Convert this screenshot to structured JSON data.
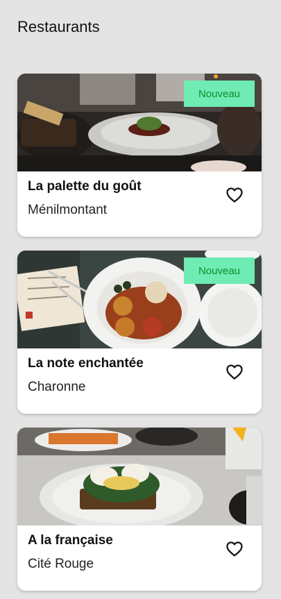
{
  "page": {
    "title": "Restaurants"
  },
  "restaurants": [
    {
      "name": "La palette du goût",
      "area": "Ménilmontant",
      "badge": "Nouveau"
    },
    {
      "name": "La note enchantée",
      "area": "Charonne",
      "badge": "Nouveau"
    },
    {
      "name": "A la française",
      "area": "Cité Rouge"
    }
  ],
  "colors": {
    "background": "#e4e4e4",
    "badge_bg": "#6fecb3",
    "badge_text": "#118a2b"
  },
  "icons": {
    "favorite": "heart-outline-icon"
  }
}
